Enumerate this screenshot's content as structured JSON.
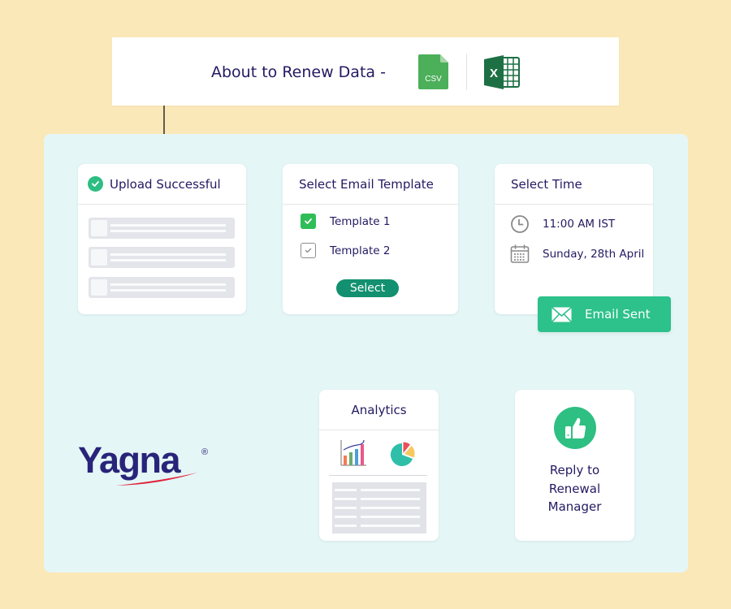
{
  "banner": {
    "title": "About to Renew Data -",
    "file_types": [
      {
        "icon": "csv-file-icon",
        "label": "CSV",
        "color": "#4caf5a"
      },
      {
        "icon": "excel-file-icon",
        "label": "X",
        "color": "#1d7044"
      }
    ]
  },
  "steps": {
    "upload": {
      "title": "Upload Successful",
      "status_icon": "check-circle-icon",
      "row_count": 3
    },
    "template": {
      "title": "Select Email Template",
      "options": [
        {
          "label": "Template 1",
          "checked": true
        },
        {
          "label": "Template 2",
          "checked": false
        }
      ],
      "button_label": "Select"
    },
    "time": {
      "title": "Select Time",
      "time": "11:00 AM IST",
      "date": "Sunday, 28th April"
    },
    "email_sent": {
      "label": "Email Sent",
      "icon": "envelope-icon"
    },
    "analytics": {
      "title": "Analytics",
      "icons": [
        "bar-chart-icon",
        "pie-chart-icon"
      ]
    },
    "reply": {
      "line1": "Reply to",
      "line2": "Renewal",
      "line3": "Manager",
      "icon": "thumbs-up-icon"
    }
  },
  "logo": {
    "text": "Yagna",
    "mark": "®"
  },
  "colors": {
    "background": "#fbe8b8",
    "panel": "#e5f6f6",
    "text": "#231a62",
    "accent_green": "#2dc18b",
    "button_green": "#12906f",
    "logo_red": "#e0203a"
  }
}
